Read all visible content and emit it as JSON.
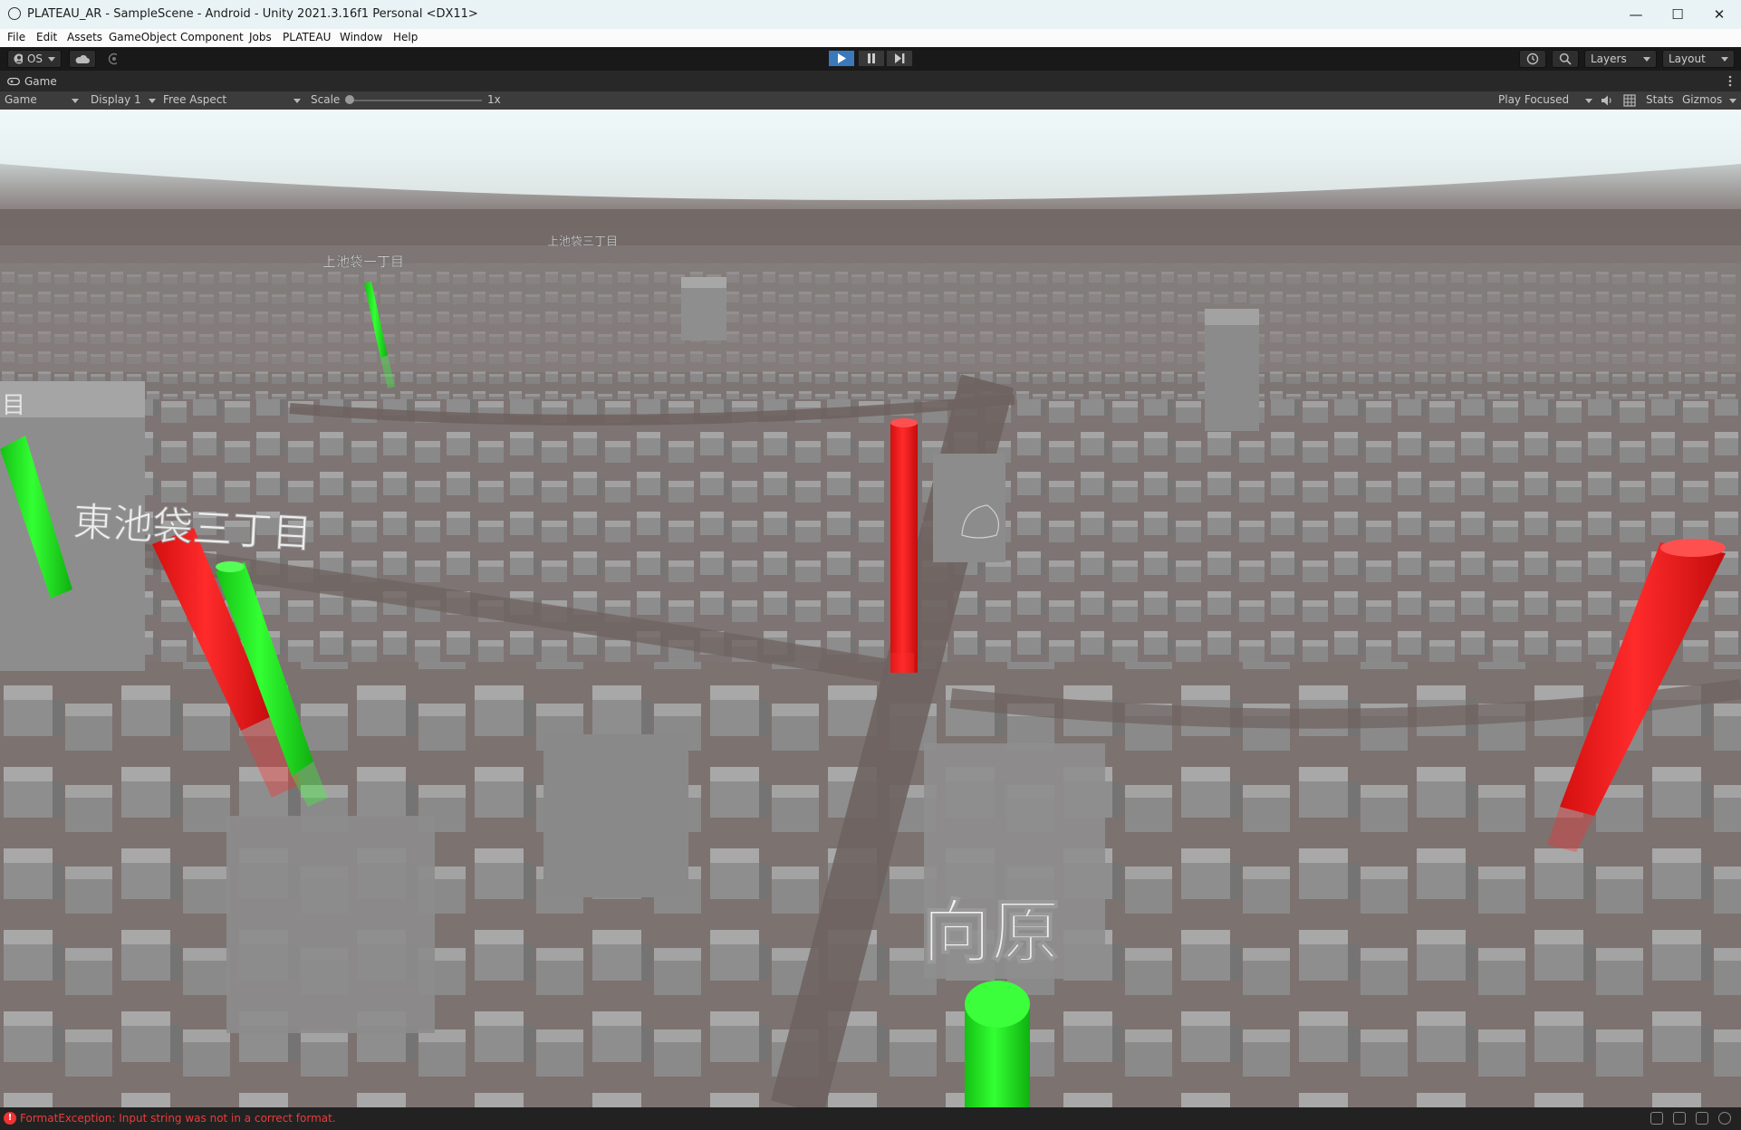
{
  "window": {
    "title": "PLATEAU_AR - SampleScene - Android - Unity 2021.3.16f1 Personal <DX11>",
    "controls": {
      "minimize": "—",
      "maximize": "☐",
      "close": "✕"
    }
  },
  "menu": [
    "File",
    "Edit",
    "Assets",
    "GameObject",
    "Component",
    "Jobs",
    "PLATEAU",
    "Window",
    "Help"
  ],
  "toolbar": {
    "account_label": "OS",
    "layers_label": "Layers",
    "layout_label": "Layout"
  },
  "tab": {
    "label": "Game"
  },
  "game_bar": {
    "mode": "Game",
    "display": "Display 1",
    "aspect": "Free Aspect",
    "scale_label": "Scale",
    "scale_value": "1x",
    "play_focused": "Play Focused",
    "stats": "Stats",
    "gizmos": "Gizmos"
  },
  "scene_labels": {
    "kamiikebukuro_1": "上池袋一丁目",
    "kamiikebukuro_3": "上池袋三丁目",
    "partial_left": "目",
    "higashiikebukuro_3": "東池袋三丁目",
    "mukaihara": "向原"
  },
  "colors": {
    "play_active": "#3a79bb",
    "pin_red": "#ff1e1e",
    "pin_green": "#1ee81e",
    "error_text": "#ee3a3a"
  },
  "status": {
    "error_message": "FormatException: Input string was not in a correct format."
  }
}
